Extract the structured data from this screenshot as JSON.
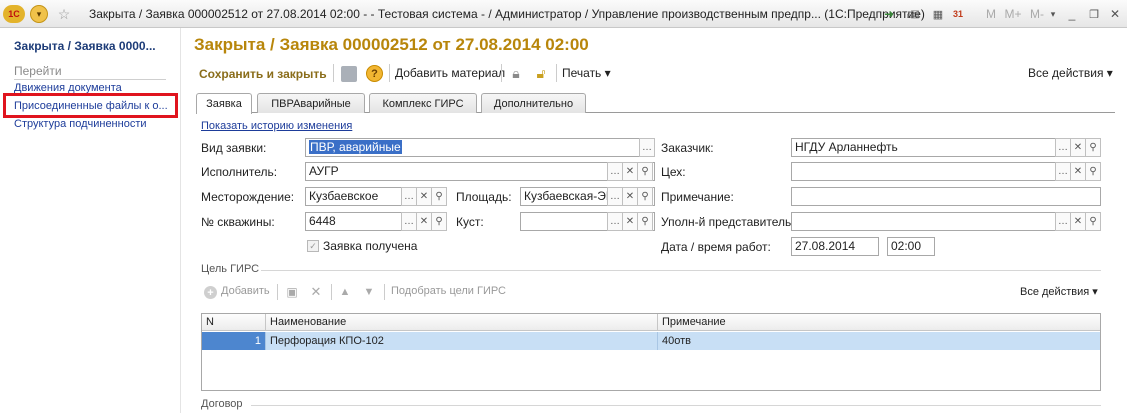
{
  "window": {
    "title": "Закрыта / Заявка 000002512 от 27.08.2014 02:00 - - Тестовая система - / Администратор / Управление производственным предпр...  (1С:Предприятие)",
    "m_buttons": [
      "M",
      "M+",
      "M-"
    ]
  },
  "sidebar": {
    "title": "Закрыта / Заявка 0000...",
    "goto_label": "Перейти",
    "links": [
      "Движения документа",
      "Присоединенные файлы к о...",
      "Структура подчиненности"
    ]
  },
  "doc": {
    "title": "Закрыта / Заявка 000002512 от 27.08.2014 02:00",
    "toolbar": {
      "save_close": "Сохранить и закрыть",
      "add_material": "Добавить материал",
      "print": "Печать ▾",
      "all_actions": "Все действия ▾"
    },
    "tabs": [
      "Заявка",
      "ПВРАварийные",
      "Комплекс ГИРС",
      "Дополнительно"
    ],
    "history_link": "Показать историю изменения",
    "fields": {
      "vid_label": "Вид заявки:",
      "vid_value": "ПВР, аварийные",
      "isp_label": "Исполнитель:",
      "isp_value": "АУГР",
      "mest_label": "Месторождение:",
      "mest_value": "Кузбаевское",
      "pl_label": "Площадь:",
      "pl_value": "Кузбаевская-ЭК",
      "skv_label": "№ скважины:",
      "skv_value": "6448",
      "kust_label": "Куст:",
      "kust_value": "",
      "zaklat_label": "Заявка получена",
      "zak_label": "Заказчик:",
      "zak_value": "НГДУ Арланнефть",
      "ceh_label": "Цех:",
      "ceh_value": "",
      "prim_label": "Примечание:",
      "prim_value": "",
      "upol_label": "Уполн-й представитель:",
      "upol_value": "",
      "dt_label": "Дата / время  работ:",
      "date_value": "27.08.2014",
      "time_value": "02:00"
    },
    "gis": {
      "section": "Цель ГИРС",
      "add": "Добавить",
      "pick": "Подобрать цели ГИРС",
      "all_actions": "Все действия ▾",
      "columns": [
        "N",
        "Наименование",
        "Примечание"
      ],
      "rows": [
        {
          "n": "1",
          "name": "Перфорация КПО-102",
          "note": "40отв"
        }
      ]
    },
    "contract_section": "Договор"
  }
}
